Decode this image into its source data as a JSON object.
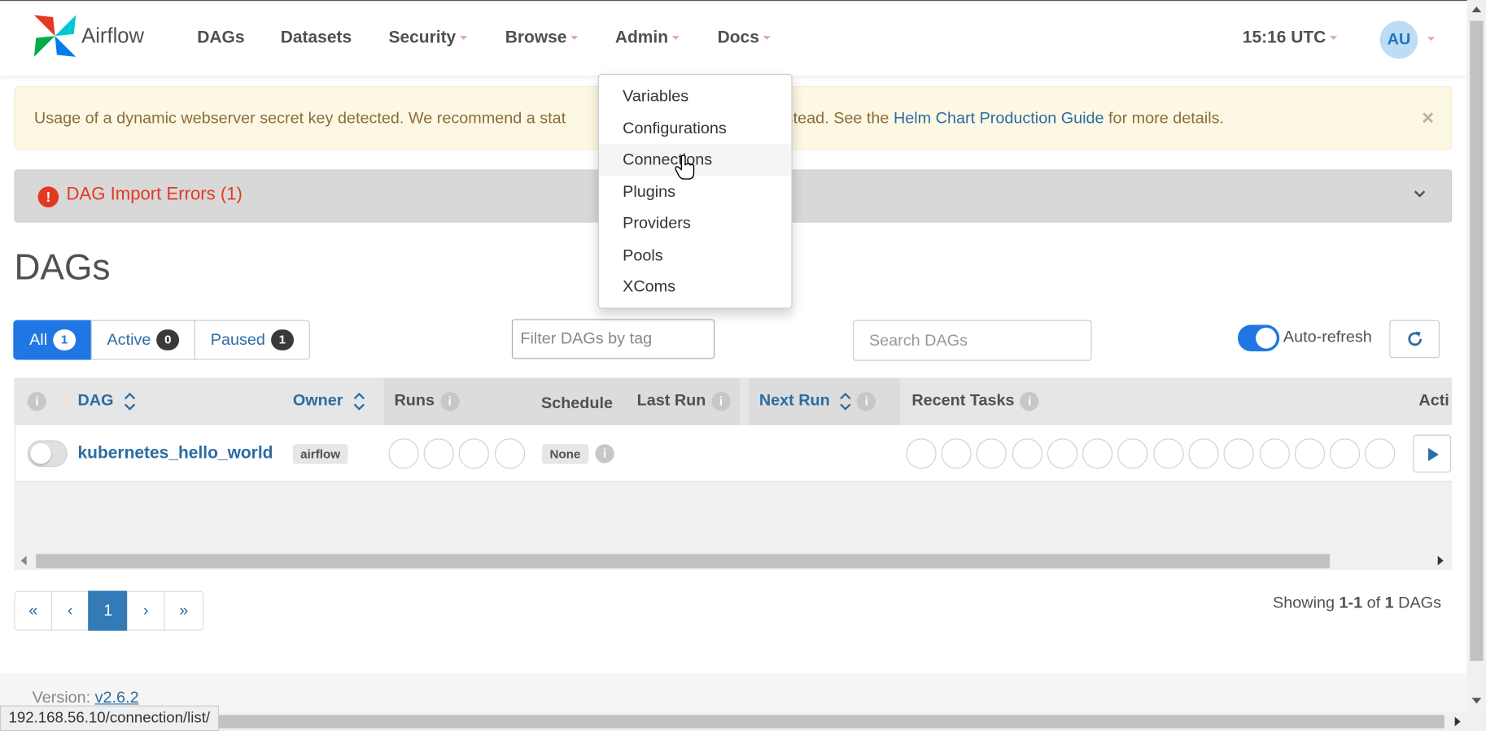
{
  "brand": {
    "name": "Airflow"
  },
  "nav": {
    "dags": "DAGs",
    "datasets": "Datasets",
    "security": "Security",
    "browse": "Browse",
    "admin": "Admin",
    "docs": "Docs",
    "clock": "15:16 UTC",
    "avatar": "AU"
  },
  "admin_menu": [
    "Variables",
    "Configurations",
    "Connections",
    "Plugins",
    "Providers",
    "Pools",
    "XComs"
  ],
  "alert": {
    "text_before": "Usage of a dynamic webserver secret key detected. We recommend a stat",
    "text_hidden_gap": "",
    "text_after": "nstead. See the ",
    "link": "Helm Chart Production Guide",
    "text_end": " for more details.",
    "close": "×"
  },
  "import_errors": {
    "icon": "!",
    "label": "DAG Import Errors (1)"
  },
  "page_title": "DAGs",
  "filters": {
    "all": "All",
    "all_count": "1",
    "active": "Active",
    "active_count": "0",
    "paused": "Paused",
    "paused_count": "1",
    "tag_placeholder": "Filter DAGs by tag",
    "search_placeholder": "Search DAGs",
    "auto_refresh": "Auto-refresh"
  },
  "table": {
    "headers": {
      "dag": "DAG",
      "owner": "Owner",
      "runs": "Runs",
      "schedule": "Schedule",
      "last_run": "Last Run",
      "next_run": "Next Run",
      "recent_tasks": "Recent Tasks",
      "actions": "Acti"
    },
    "rows": [
      {
        "dag_id": "kubernetes_hello_world",
        "owner": "airflow",
        "schedule": "None"
      }
    ]
  },
  "pagination": {
    "first": "«",
    "prev": "‹",
    "current": "1",
    "next": "›",
    "last": "»"
  },
  "showing": {
    "prefix": "Showing ",
    "range": "1-1",
    "of": " of ",
    "total": "1",
    "suffix": " DAGs"
  },
  "footer": {
    "version_label": "Version: ",
    "version": "v2.6.2"
  },
  "status_url": "192.168.56.10/connection/list/",
  "colors": {
    "accent": "#1f76e5",
    "link": "#2b6ca3",
    "error": "#e43921",
    "alert_bg": "#fcf8e3"
  }
}
